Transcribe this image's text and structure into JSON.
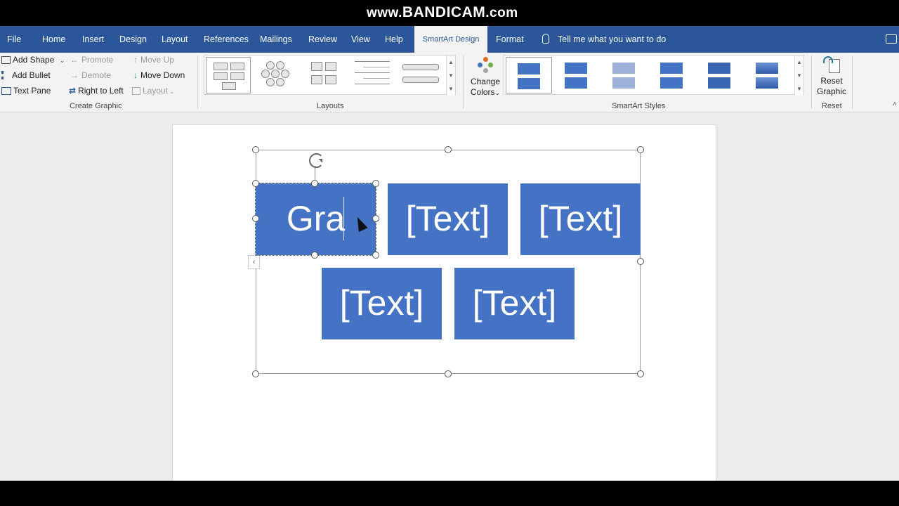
{
  "watermark": {
    "part1": "www.",
    "part2": "BANDICAM",
    "part3": ".com"
  },
  "tabs": [
    {
      "label": "File"
    },
    {
      "label": "Home"
    },
    {
      "label": "Insert"
    },
    {
      "label": "Design"
    },
    {
      "label": "Layout"
    },
    {
      "label": "References"
    },
    {
      "label": "Mailings"
    },
    {
      "label": "Review"
    },
    {
      "label": "View"
    },
    {
      "label": "Help"
    },
    {
      "label": "SmartArt Design"
    },
    {
      "label": "Format"
    }
  ],
  "tell_me": "Tell me what you want to do",
  "create_graphic": {
    "add_shape": "Add Shape",
    "add_bullet": "Add Bullet",
    "text_pane": "Text Pane",
    "promote": "Promote",
    "demote": "Demote",
    "right_to_left": "Right to Left",
    "move_up": "Move Up",
    "move_down": "Move Down",
    "layout": "Layout",
    "label": "Create Graphic"
  },
  "layouts": {
    "label": "Layouts"
  },
  "change_colors": {
    "line1": "Change",
    "line2": "Colors"
  },
  "smartart_styles": {
    "label": "SmartArt Styles"
  },
  "reset": {
    "line1": "Reset",
    "line2": "Graphic",
    "label": "Reset"
  },
  "smartart": {
    "shapes": [
      {
        "text": "Gra"
      },
      {
        "text": "[Text]"
      },
      {
        "text": "[Text]"
      },
      {
        "text": "[Text]"
      },
      {
        "text": "[Text]"
      }
    ]
  },
  "colors": {
    "ribbon_tab": "#2b579a",
    "shape_fill": "#4472c4"
  }
}
